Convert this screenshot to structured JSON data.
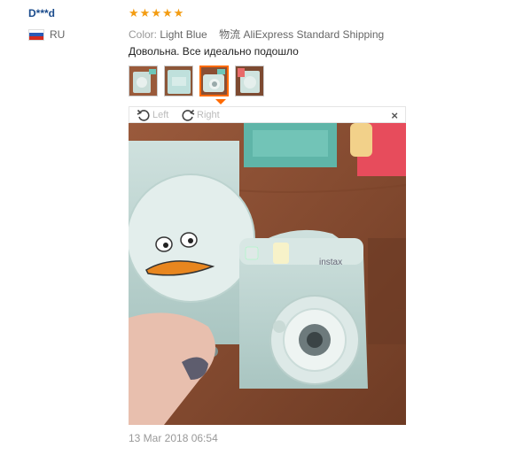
{
  "user": {
    "name": "D***d",
    "country": "RU"
  },
  "rating": {
    "stars": 5,
    "max": 5
  },
  "order": {
    "color_label": "Color:",
    "color_value": "Light Blue",
    "shipping_prefix": "物流",
    "shipping_value": "AliExpress Standard Shipping"
  },
  "review": {
    "text": "Довольна. Все идеально подошло",
    "timestamp": "13 Mar 2018 06:54"
  },
  "viewer": {
    "left_label": "Left",
    "right_label": "Right",
    "close_label": "×"
  },
  "thumbnails": {
    "count": 4,
    "active_index": 2
  },
  "colors": {
    "star": "#f39c12",
    "active_border": "#ff6a00",
    "user_link": "#1a4b8c"
  }
}
